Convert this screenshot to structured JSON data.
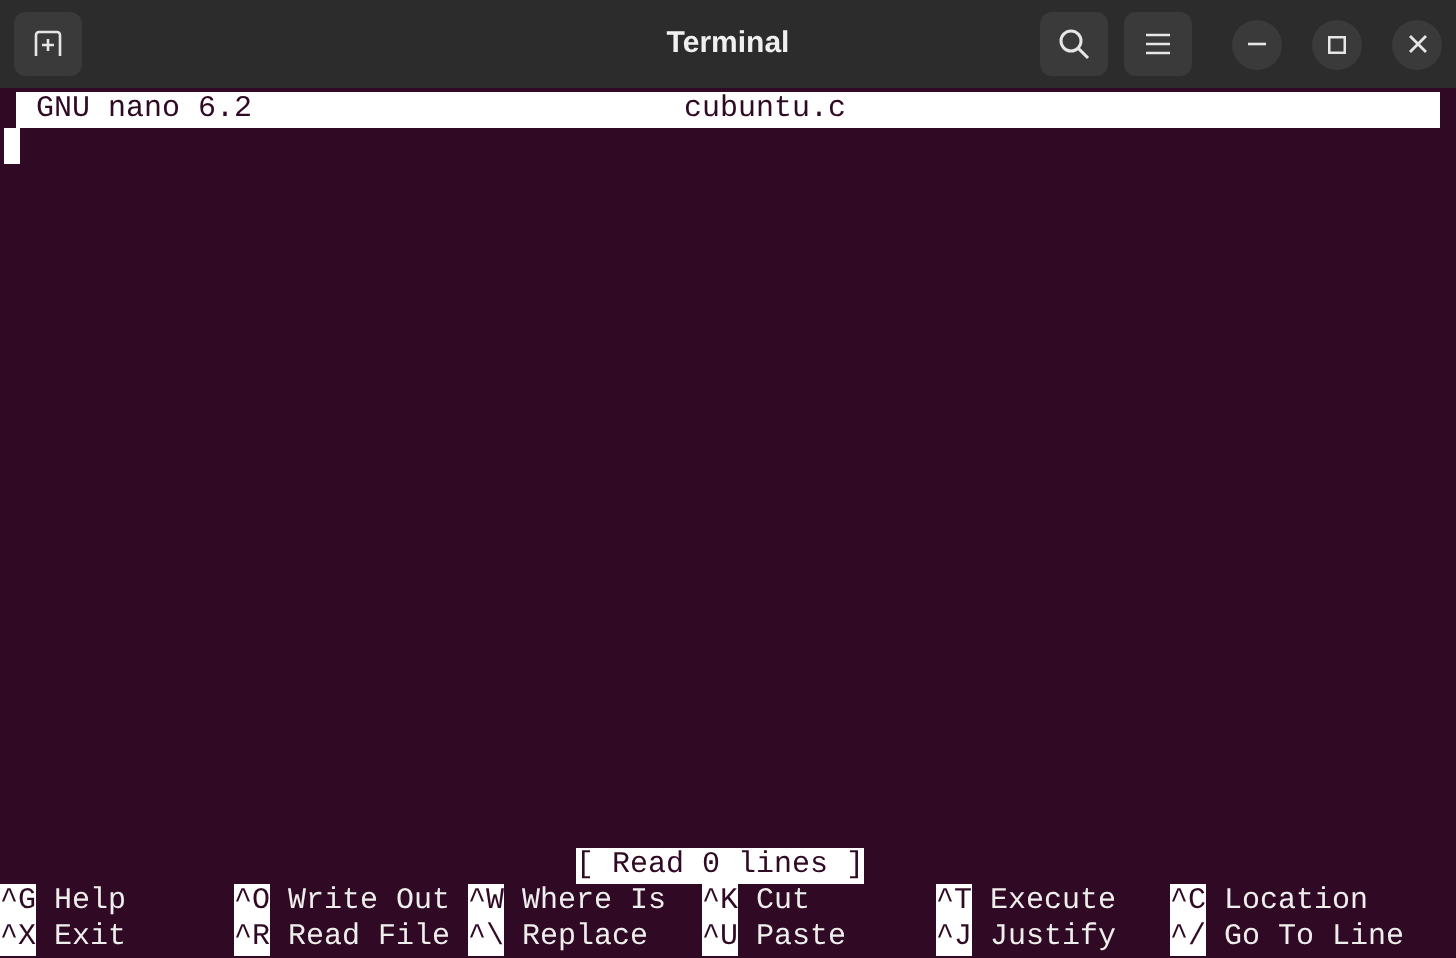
{
  "window": {
    "title": "Terminal"
  },
  "nano": {
    "version": "GNU nano 6.2",
    "filename": "cubuntu.c",
    "status": "[ Read 0 lines ]",
    "shortcuts": [
      {
        "key": "^G",
        "label": "Help"
      },
      {
        "key": "^O",
        "label": "Write Out"
      },
      {
        "key": "^W",
        "label": "Where Is"
      },
      {
        "key": "^K",
        "label": "Cut"
      },
      {
        "key": "^T",
        "label": "Execute"
      },
      {
        "key": "^C",
        "label": "Location"
      },
      {
        "key": "^X",
        "label": "Exit"
      },
      {
        "key": "^R",
        "label": "Read File"
      },
      {
        "key": "^\\",
        "label": "Replace"
      },
      {
        "key": "^U",
        "label": "Paste"
      },
      {
        "key": "^J",
        "label": "Justify"
      },
      {
        "key": "^/",
        "label": "Go To Line"
      }
    ]
  }
}
